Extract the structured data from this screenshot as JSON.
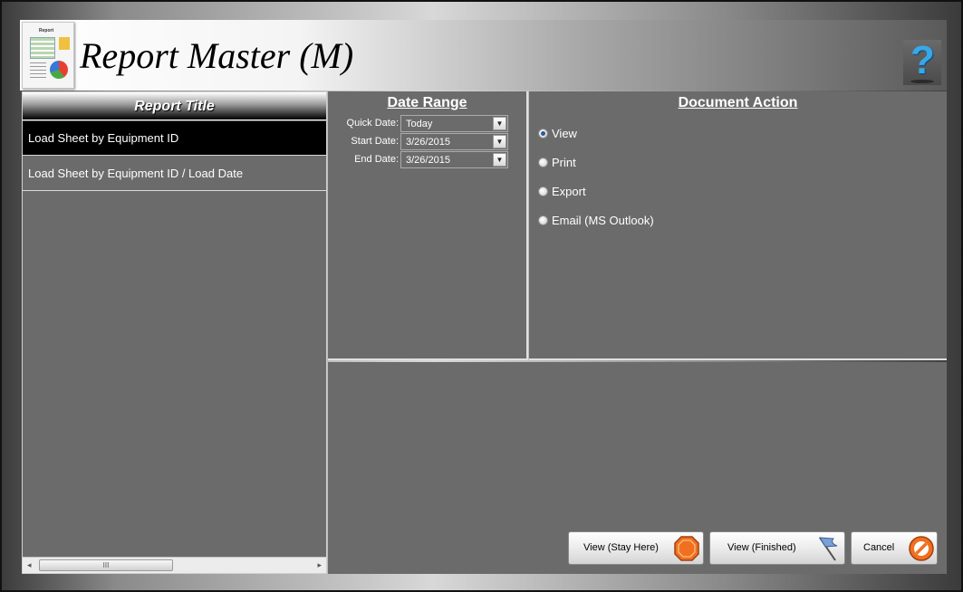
{
  "header": {
    "title": "Report Master (M)",
    "icon": "report-document-icon",
    "icon_text": "Report",
    "help_icon": "question-mark-icon",
    "help_glyph": "?"
  },
  "report_list": {
    "header": "Report Title",
    "items": [
      {
        "label": "Load Sheet by Equipment ID",
        "selected": true
      },
      {
        "label": "Load Sheet by Equipment ID / Load Date",
        "selected": false
      }
    ],
    "scrollbar": {
      "left_arrow": "◂",
      "right_arrow": "▸",
      "grip": "III"
    }
  },
  "date_range": {
    "title": "Date Range",
    "quick_date": {
      "label": "Quick Date:",
      "value": "Today"
    },
    "start_date": {
      "label": "Start Date:",
      "value": "3/26/2015"
    },
    "end_date": {
      "label": "End Date:",
      "value": "3/26/2015"
    },
    "dropdown_glyph": "▼"
  },
  "document_action": {
    "title": "Document Action",
    "options": [
      {
        "label": "View",
        "checked": true
      },
      {
        "label": "Print",
        "checked": false
      },
      {
        "label": "Export",
        "checked": false
      },
      {
        "label": "Email (MS Outlook)",
        "checked": false
      }
    ]
  },
  "buttons": {
    "view_stay": {
      "label": "View (Stay Here)",
      "icon": "stop-octagon-icon"
    },
    "view_finished": {
      "label": "View (Finished)",
      "icon": "flag-icon"
    },
    "cancel": {
      "label": "Cancel",
      "icon": "cancel-circle-icon"
    }
  },
  "colors": {
    "panel_bg": "#6b6b6b",
    "selected_bg": "#000000",
    "help_blue": "#38a8e8",
    "stop_orange": "#f07020",
    "flag_blue": "#7aa0d8"
  }
}
